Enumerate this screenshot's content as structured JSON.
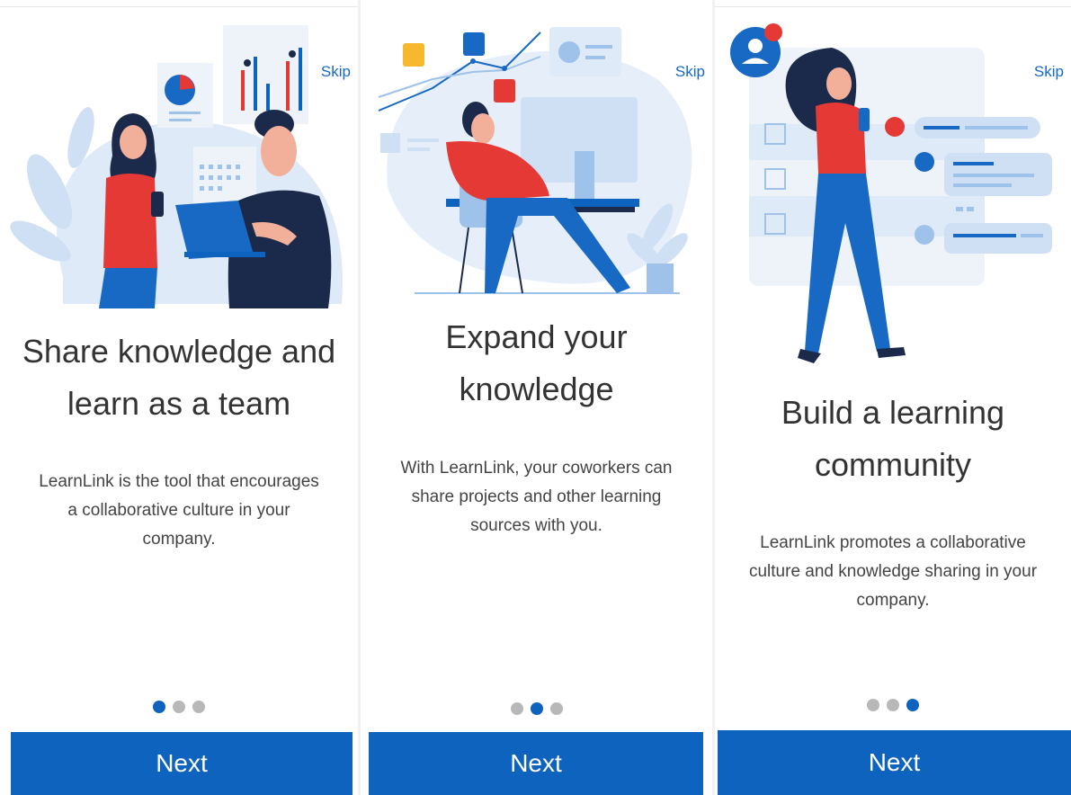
{
  "colors": {
    "brand_blue": "#0d63bd",
    "accent_red": "#e53935",
    "light_blue": "#dfeaf8"
  },
  "screens": [
    {
      "skip": "Skip",
      "illustration": "two-coworkers-laptop-illustration",
      "title_line1": "Share knowledge and",
      "title_line2": "learn as a team",
      "desc_line1": "LearnLink is the tool that encourages",
      "desc_line2": "a collaborative culture in your",
      "desc_line3": "company.",
      "active_dot": 1,
      "next": "Next"
    },
    {
      "skip": "Skip",
      "illustration": "woman-at-desk-computer-illustration",
      "title_line1": "Expand your",
      "title_line2": "knowledge",
      "desc_line1": "With LearnLink, your coworkers can",
      "desc_line2": "share projects and other learning",
      "desc_line3": "sources with you.",
      "active_dot": 2,
      "next": "Next"
    },
    {
      "skip": "Skip",
      "illustration": "woman-walking-phone-illustration",
      "title_line1": "Build a learning",
      "title_line2": "community",
      "desc_line1": "LearnLink promotes a collaborative",
      "desc_line2": "culture and knowledge sharing in your",
      "desc_line3": "company.",
      "active_dot": 3,
      "next": "Next"
    }
  ]
}
